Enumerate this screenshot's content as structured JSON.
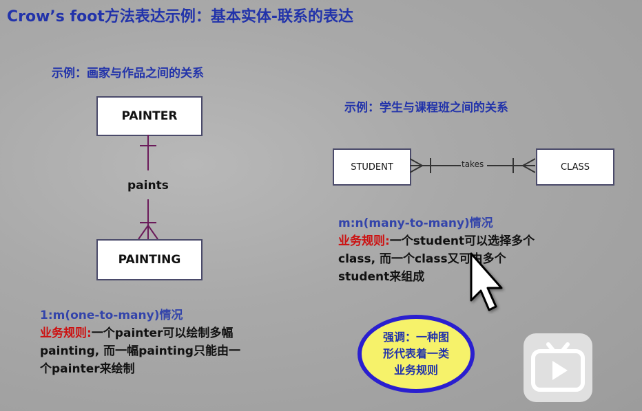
{
  "title": "Crow’s foot方法表达示例：基本实体-联系的表达",
  "left": {
    "heading": "示例：画家与作品之间的关系",
    "entity1": "PAINTER",
    "relationship": "paints",
    "entity2": "PAINTING",
    "rule_title": "1:m(one-to-many)情况",
    "rule_key": "业务规则:",
    "rule_text_1": "一个painter可以绘制多幅",
    "rule_text_2": "painting, 而一幅painting只能由一",
    "rule_text_3": "个painter来绘制"
  },
  "right": {
    "heading": "示例：学生与课程班之间的关系",
    "entity1": "STUDENT",
    "relationship": "takes",
    "entity2": "CLASS",
    "rule_title": "m:n(many-to-many)情况",
    "rule_key": "业务规则:",
    "rule_text_1": "一个student可以选择多个",
    "rule_text_2": "class, 而一个class又可由多个",
    "rule_text_3": "student来组成"
  },
  "callout": {
    "line1": "强调：一种图",
    "line2": "形代表着一类",
    "line3": "业务规则"
  },
  "colors": {
    "heading": "#2233aa",
    "rule_key": "#cc1111",
    "callout_fill": "#f6f26a",
    "callout_border": "#2a1fcf"
  },
  "icons": [
    "mouse-cursor-icon",
    "play-icon"
  ]
}
